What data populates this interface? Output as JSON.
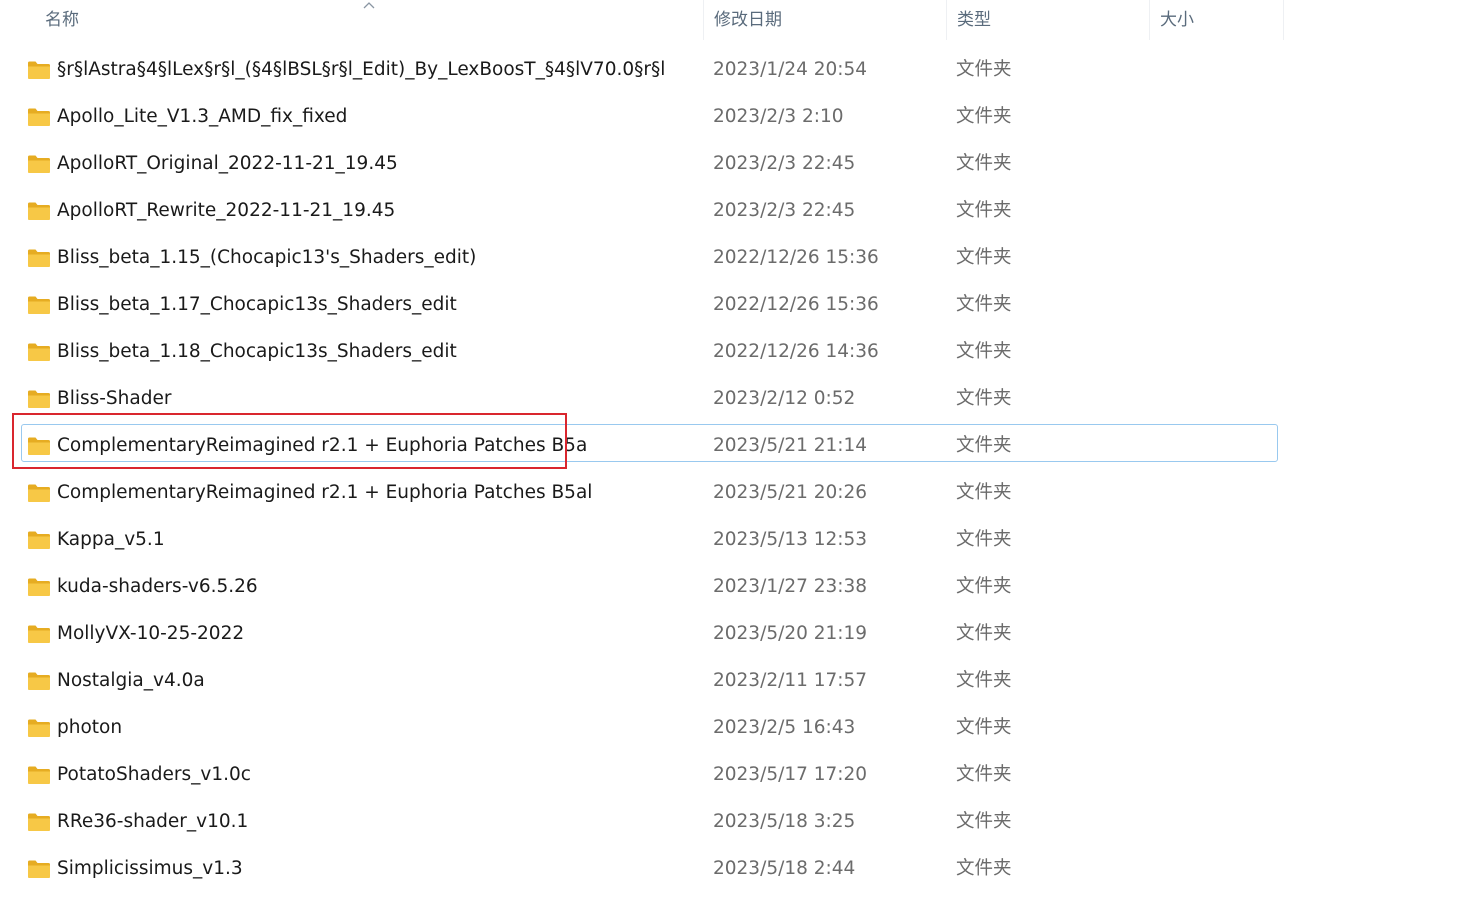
{
  "columns": {
    "name": "名称",
    "date": "修改日期",
    "type": "类型",
    "size": "大小"
  },
  "sort_icon": "sort-ascending-caret-icon",
  "colors": {
    "folder": "#f7c846",
    "folder_dark": "#e6ac22",
    "selection_border": "#99c9ef",
    "highlight": "#d9262e"
  },
  "files": [
    {
      "name": "§r§lAstra§4§lLex§r§l_(§4§lBSL§r§l_Edit)_By_LexBoosT_§4§lV70.0§r§l",
      "date": "2023/1/24 20:54",
      "type": "文件夹"
    },
    {
      "name": "Apollo_Lite_V1.3_AMD_fix_fixed",
      "date": "2023/2/3 2:10",
      "type": "文件夹"
    },
    {
      "name": "ApolloRT_Original_2022-11-21_19.45",
      "date": "2023/2/3 22:45",
      "type": "文件夹"
    },
    {
      "name": "ApolloRT_Rewrite_2022-11-21_19.45",
      "date": "2023/2/3 22:45",
      "type": "文件夹"
    },
    {
      "name": "Bliss_beta_1.15_(Chocapic13's_Shaders_edit)",
      "date": "2022/12/26 15:36",
      "type": "文件夹"
    },
    {
      "name": "Bliss_beta_1.17_Chocapic13s_Shaders_edit",
      "date": "2022/12/26 15:36",
      "type": "文件夹"
    },
    {
      "name": "Bliss_beta_1.18_Chocapic13s_Shaders_edit",
      "date": "2022/12/26 14:36",
      "type": "文件夹"
    },
    {
      "name": "Bliss-Shader",
      "date": "2023/2/12 0:52",
      "type": "文件夹"
    },
    {
      "name": "ComplementaryReimagined r2.1 + Euphoria Patches B5a",
      "date": "2023/5/21 21:14",
      "type": "文件夹",
      "selected": true
    },
    {
      "name": "ComplementaryReimagined r2.1 + Euphoria Patches B5al",
      "date": "2023/5/21 20:26",
      "type": "文件夹"
    },
    {
      "name": "Kappa_v5.1",
      "date": "2023/5/13 12:53",
      "type": "文件夹"
    },
    {
      "name": "kuda-shaders-v6.5.26",
      "date": "2023/1/27 23:38",
      "type": "文件夹"
    },
    {
      "name": "MollyVX-10-25-2022",
      "date": "2023/5/20 21:19",
      "type": "文件夹"
    },
    {
      "name": "Nostalgia_v4.0a",
      "date": "2023/2/11 17:57",
      "type": "文件夹"
    },
    {
      "name": "photon",
      "date": "2023/2/5 16:43",
      "type": "文件夹"
    },
    {
      "name": "PotatoShaders_v1.0c",
      "date": "2023/5/17 17:20",
      "type": "文件夹"
    },
    {
      "name": "RRe36-shader_v10.1",
      "date": "2023/5/18 3:25",
      "type": "文件夹"
    },
    {
      "name": "Simplicissimus_v1.3",
      "date": "2023/5/18 2:44",
      "type": "文件夹"
    }
  ]
}
